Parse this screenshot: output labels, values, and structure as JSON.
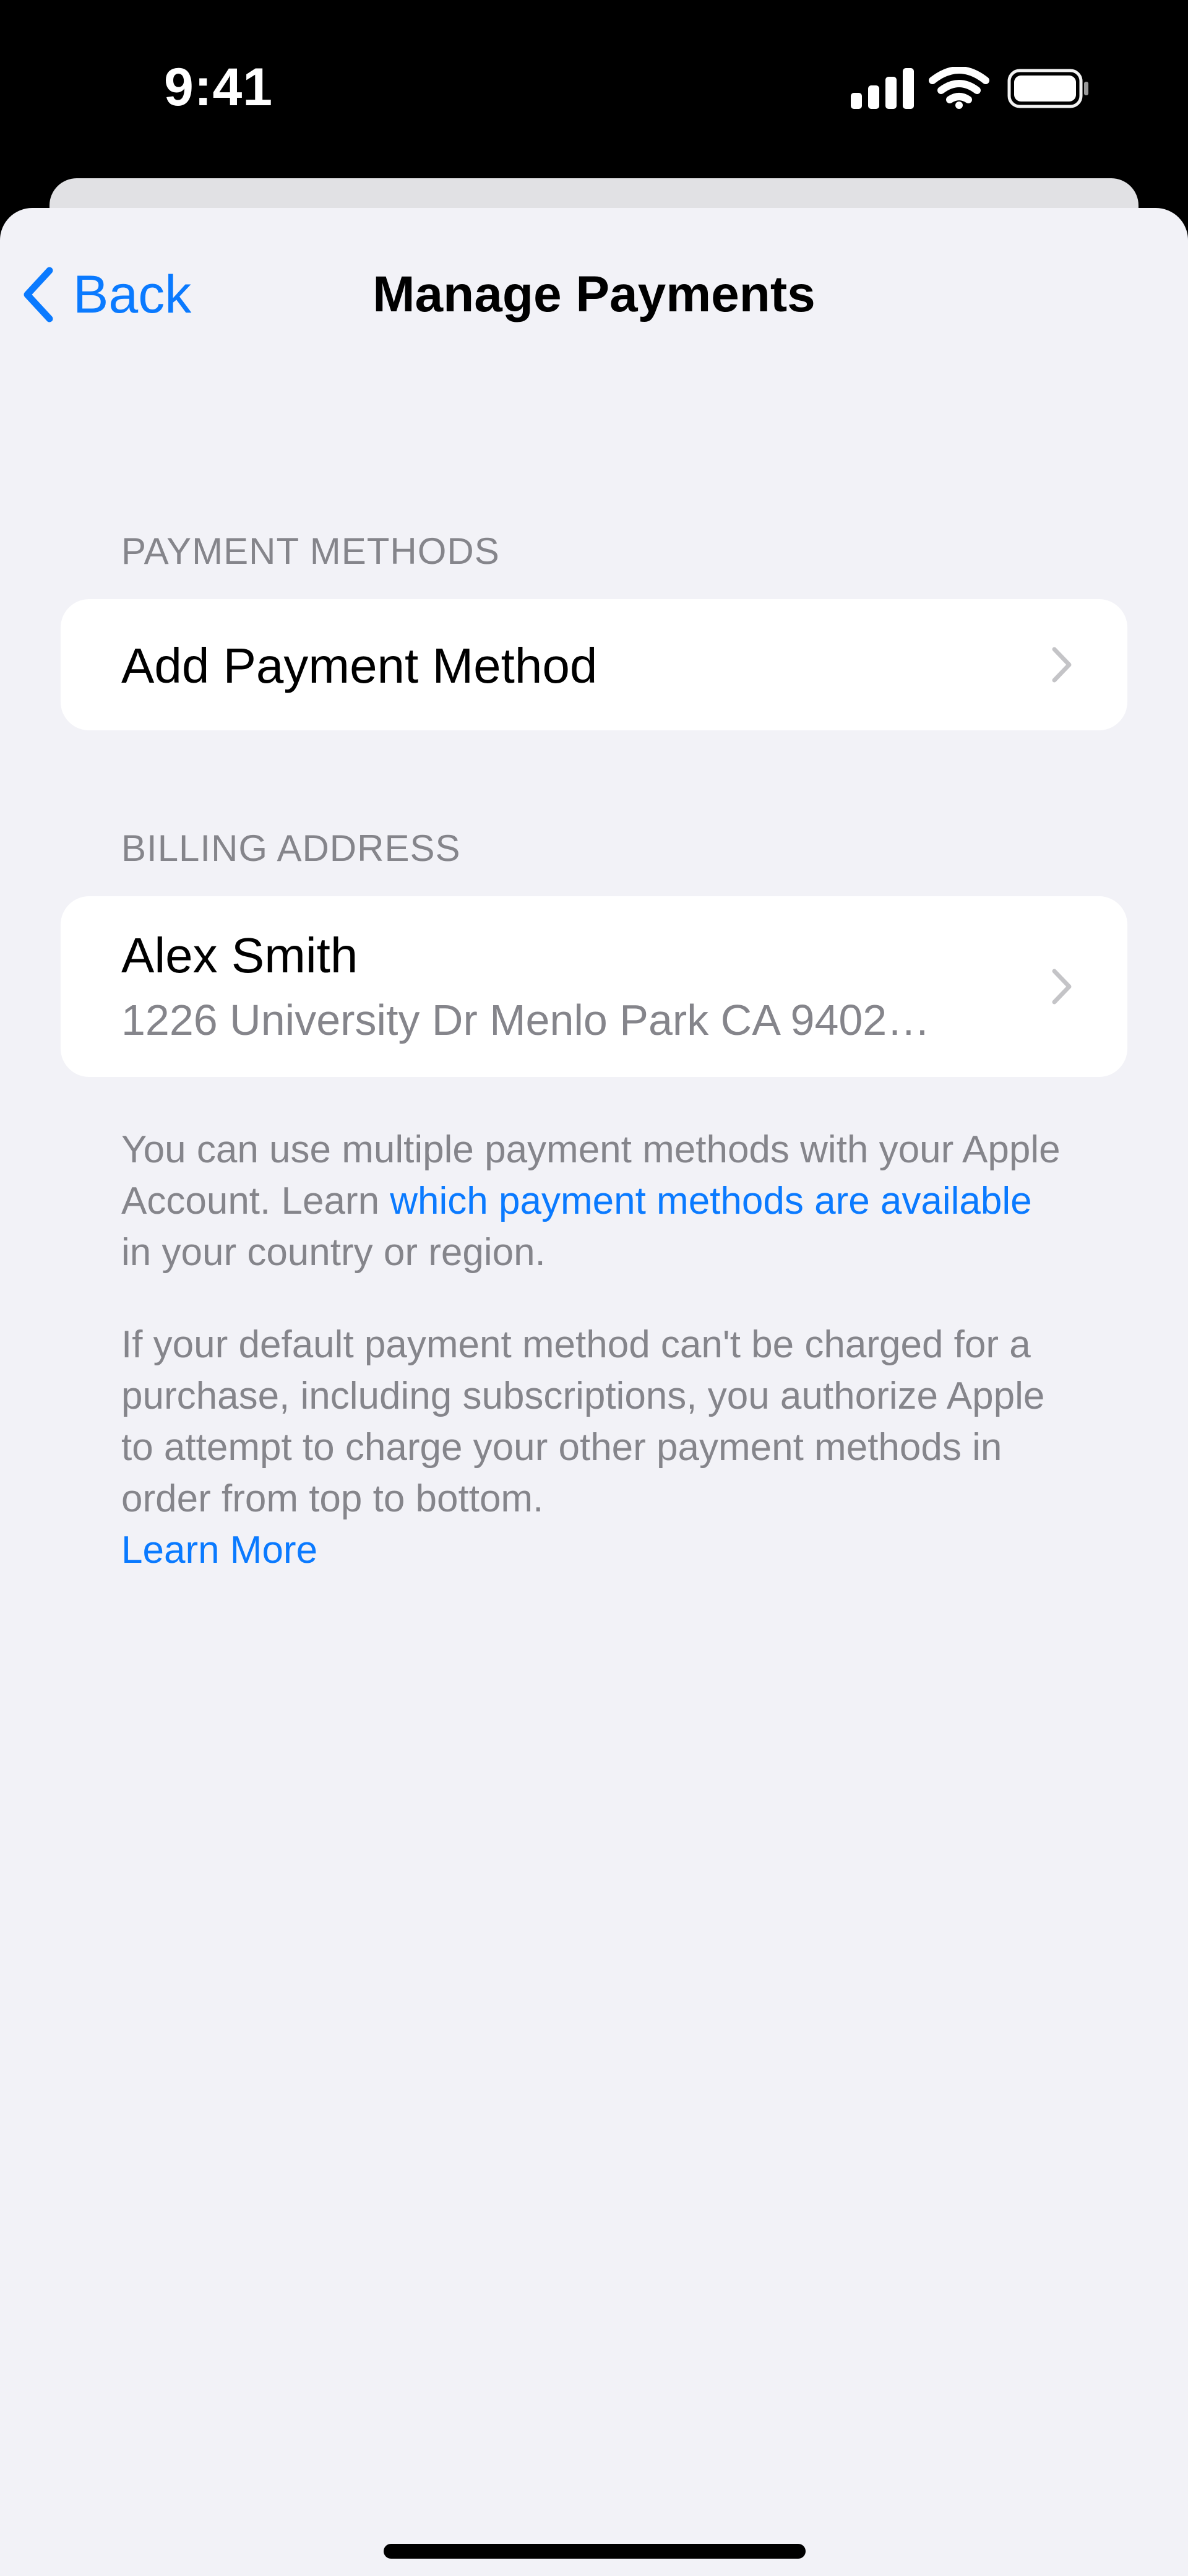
{
  "status_bar": {
    "time": "9:41"
  },
  "nav": {
    "back_label": "Back",
    "title": "Manage Payments"
  },
  "payment_methods": {
    "header": "PAYMENT METHODS",
    "add_label": "Add Payment Method"
  },
  "billing": {
    "header": "BILLING ADDRESS",
    "name": "Alex Smith",
    "address": "1226 University Dr Menlo Park CA 9402…"
  },
  "footer": {
    "p1_text_a": "You can use multiple payment methods with your Apple Account. Learn ",
    "p1_link": "which payment methods are available",
    "p1_text_b": " in your country or region.",
    "p2_text": "If your default payment method can't be charged for a purchase, including subscriptions, you authorize Apple to attempt to charge your other payment methods in order from top to bottom.",
    "p2_link": "Learn More"
  },
  "colors": {
    "accent": "#0a7aff",
    "background": "#f2f2f7",
    "secondary_text": "#85858b"
  },
  "icons": {
    "back": "chevron-left-icon",
    "row": "chevron-right-icon",
    "signal": "cellular-signal-icon",
    "wifi": "wifi-icon",
    "battery": "battery-icon"
  }
}
